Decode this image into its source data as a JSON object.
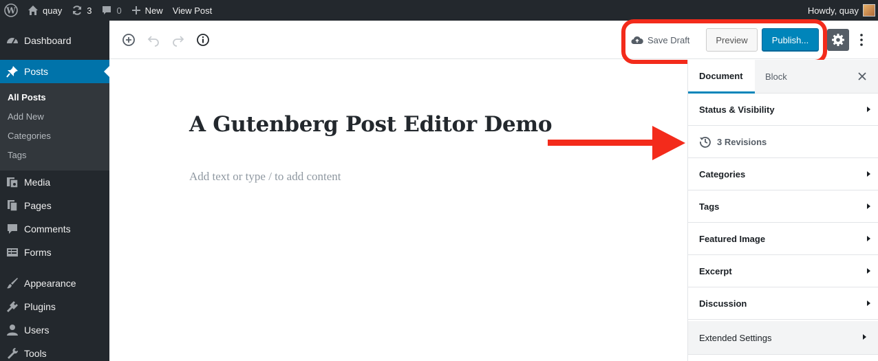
{
  "admin_bar": {
    "site_name": "quay",
    "updates_count": "3",
    "comments_count": "0",
    "new_label": "New",
    "view_post_label": "View Post",
    "greeting": "Howdy, quay"
  },
  "sidebar": {
    "items": [
      {
        "label": "Dashboard",
        "icon": "dashboard-icon"
      },
      {
        "label": "Posts",
        "icon": "pin-icon"
      },
      {
        "label": "Media",
        "icon": "media-icon"
      },
      {
        "label": "Pages",
        "icon": "pages-icon"
      },
      {
        "label": "Comments",
        "icon": "comment-icon"
      },
      {
        "label": "Forms",
        "icon": "forms-icon"
      },
      {
        "label": "Appearance",
        "icon": "brush-icon"
      },
      {
        "label": "Plugins",
        "icon": "plug-icon"
      },
      {
        "label": "Users",
        "icon": "user-icon"
      },
      {
        "label": "Tools",
        "icon": "wrench-icon"
      }
    ],
    "submenu": [
      "All Posts",
      "Add New",
      "Categories",
      "Tags"
    ]
  },
  "header": {
    "save_draft": "Save Draft",
    "preview": "Preview",
    "publish": "Publish..."
  },
  "post": {
    "title": "A Gutenberg Post Editor Demo",
    "placeholder": "Add text or type / to add content"
  },
  "settings": {
    "tabs": [
      "Document",
      "Block"
    ],
    "rows": [
      "Status & Visibility",
      "3 Revisions",
      "Categories",
      "Tags",
      "Featured Image",
      "Excerpt",
      "Discussion",
      "Extended Settings"
    ]
  },
  "colors": {
    "admin_dark": "#23282d",
    "active_blue": "#0073aa",
    "publish_blue": "#0085ba",
    "annotation_red": "#f32b1b"
  }
}
